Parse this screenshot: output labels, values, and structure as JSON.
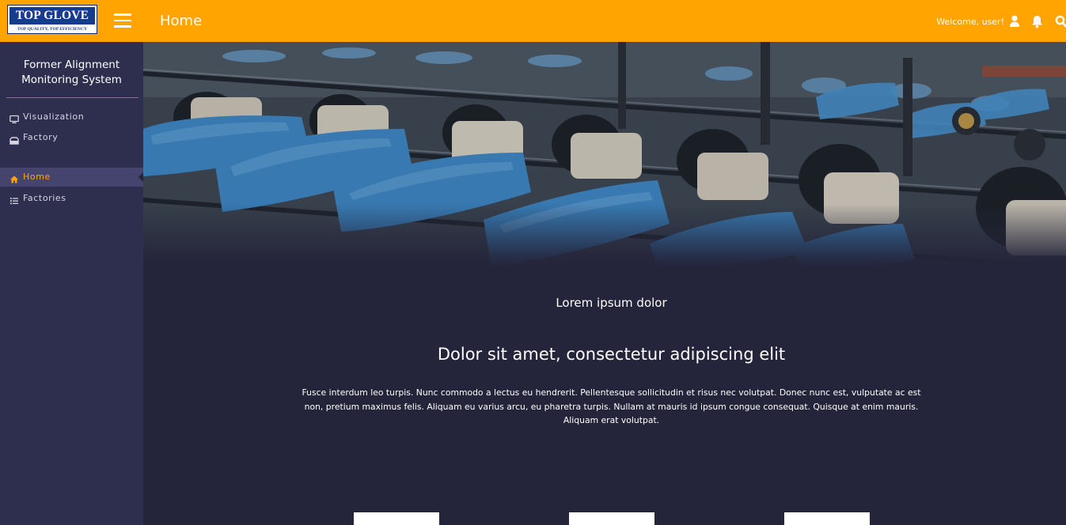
{
  "brand": {
    "name": "TOP GLOVE",
    "tagline": "TOP QUALITY, TOP EFFICIENCY",
    "accent_color": "#ffa400"
  },
  "header": {
    "title": "Home",
    "welcome_text": "Welcome, user!",
    "icons": [
      "menu-icon",
      "user-icon",
      "bell-icon",
      "search-icon"
    ]
  },
  "sidebar": {
    "title_line1": "Former Alignment",
    "title_line2": "Monitoring System",
    "top_items": [
      {
        "label": "Visualization",
        "icon": "monitor-icon"
      },
      {
        "label": "Factory",
        "icon": "factory-icon"
      }
    ],
    "nav_items": [
      {
        "label": "Home",
        "icon": "home-icon",
        "active": true
      },
      {
        "label": "Factories",
        "icon": "list-icon",
        "active": false
      }
    ],
    "background_color": "#2e2e4e",
    "active_background_color": "#44446e"
  },
  "main": {
    "eyebrow": "Lorem ipsum dolor",
    "headline": "Dolor sit amet, consectetur adipiscing elit",
    "body": "Fusce interdum leo turpis. Nunc commodo a lectus eu hendrerit. Pellentesque sollicitudin et risus nec volutpat. Donec nunc est, vulputate ac est non, pretium maximus felis. Aliquam eu varius arcu, eu pharetra turpis. Nullam at mauris id ipsum congue consequat. Quisque at enim mauris. Aliquam erat volutpat.",
    "background_color": "#24243a"
  }
}
